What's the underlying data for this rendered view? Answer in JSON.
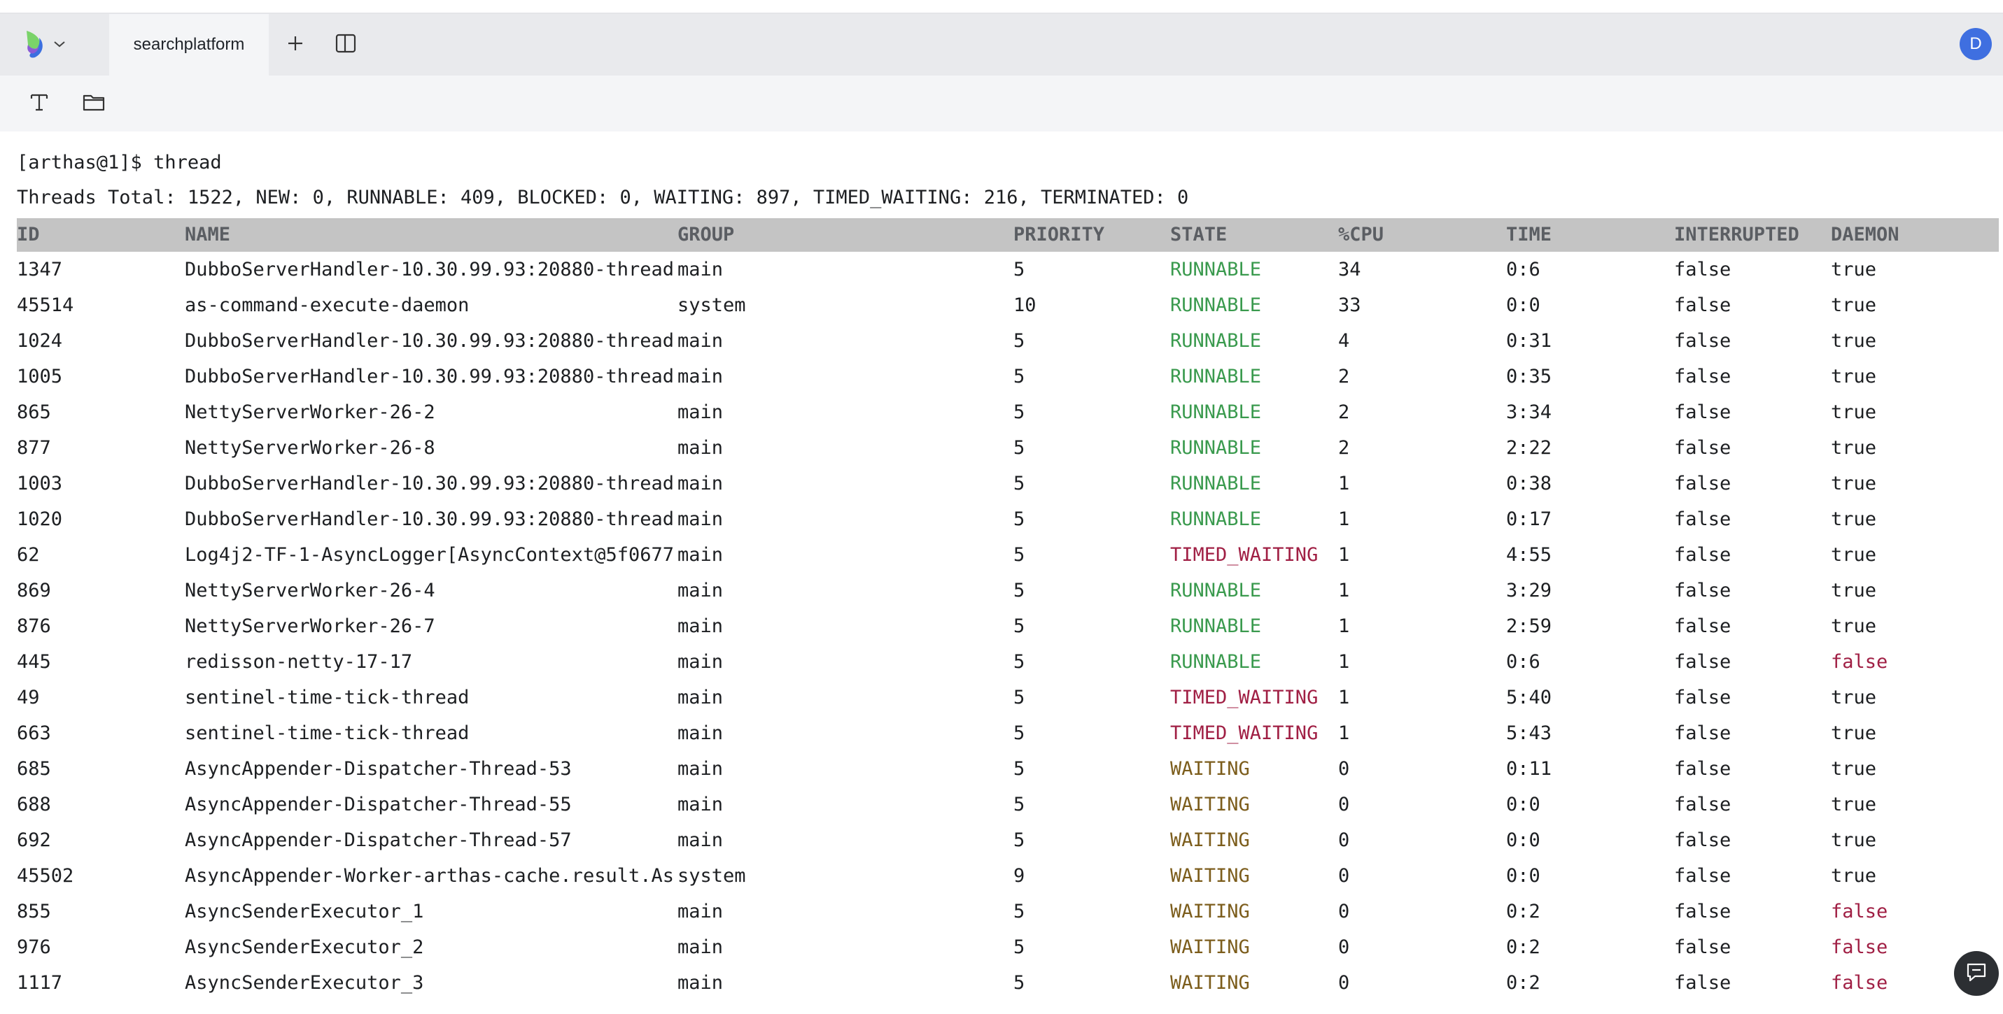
{
  "tabbar": {
    "tab_label": "searchplatform",
    "avatar_initial": "D"
  },
  "terminal": {
    "command_line": "[arthas@1]$ thread",
    "summary_line": "Threads Total: 1522, NEW: 0, RUNNABLE: 409, BLOCKED: 0, WAITING: 897, TIMED_WAITING: 216, TERMINATED: 0",
    "columns": [
      "ID",
      "NAME",
      "GROUP",
      "PRIORITY",
      "STATE",
      "%CPU",
      "TIME",
      "INTERRUPTED",
      "DAEMON"
    ],
    "rows": [
      [
        "1347",
        "DubboServerHandler-10.30.99.93:20880-thread",
        "main",
        "5",
        "RUNNABLE",
        "34",
        "0:6",
        "false",
        "true"
      ],
      [
        "45514",
        "as-command-execute-daemon",
        "system",
        "10",
        "RUNNABLE",
        "33",
        "0:0",
        "false",
        "true"
      ],
      [
        "1024",
        "DubboServerHandler-10.30.99.93:20880-thread",
        "main",
        "5",
        "RUNNABLE",
        "4",
        "0:31",
        "false",
        "true"
      ],
      [
        "1005",
        "DubboServerHandler-10.30.99.93:20880-thread",
        "main",
        "5",
        "RUNNABLE",
        "2",
        "0:35",
        "false",
        "true"
      ],
      [
        "865",
        "NettyServerWorker-26-2",
        "main",
        "5",
        "RUNNABLE",
        "2",
        "3:34",
        "false",
        "true"
      ],
      [
        "877",
        "NettyServerWorker-26-8",
        "main",
        "5",
        "RUNNABLE",
        "2",
        "2:22",
        "false",
        "true"
      ],
      [
        "1003",
        "DubboServerHandler-10.30.99.93:20880-thread",
        "main",
        "5",
        "RUNNABLE",
        "1",
        "0:38",
        "false",
        "true"
      ],
      [
        "1020",
        "DubboServerHandler-10.30.99.93:20880-thread",
        "main",
        "5",
        "RUNNABLE",
        "1",
        "0:17",
        "false",
        "true"
      ],
      [
        "62",
        "Log4j2-TF-1-AsyncLogger[AsyncContext@5f0677",
        "main",
        "5",
        "TIMED_WAITING",
        "1",
        "4:55",
        "false",
        "true"
      ],
      [
        "869",
        "NettyServerWorker-26-4",
        "main",
        "5",
        "RUNNABLE",
        "1",
        "3:29",
        "false",
        "true"
      ],
      [
        "876",
        "NettyServerWorker-26-7",
        "main",
        "5",
        "RUNNABLE",
        "1",
        "2:59",
        "false",
        "true"
      ],
      [
        "445",
        "redisson-netty-17-17",
        "main",
        "5",
        "RUNNABLE",
        "1",
        "0:6",
        "false",
        "false"
      ],
      [
        "49",
        "sentinel-time-tick-thread",
        "main",
        "5",
        "TIMED_WAITING",
        "1",
        "5:40",
        "false",
        "true"
      ],
      [
        "663",
        "sentinel-time-tick-thread",
        "main",
        "5",
        "TIMED_WAITING",
        "1",
        "5:43",
        "false",
        "true"
      ],
      [
        "685",
        "AsyncAppender-Dispatcher-Thread-53",
        "main",
        "5",
        "WAITING",
        "0",
        "0:11",
        "false",
        "true"
      ],
      [
        "688",
        "AsyncAppender-Dispatcher-Thread-55",
        "main",
        "5",
        "WAITING",
        "0",
        "0:0",
        "false",
        "true"
      ],
      [
        "692",
        "AsyncAppender-Dispatcher-Thread-57",
        "main",
        "5",
        "WAITING",
        "0",
        "0:0",
        "false",
        "true"
      ],
      [
        "45502",
        "AsyncAppender-Worker-arthas-cache.result.As",
        "system",
        "9",
        "WAITING",
        "0",
        "0:0",
        "false",
        "true"
      ],
      [
        "855",
        "AsyncSenderExecutor_1",
        "main",
        "5",
        "WAITING",
        "0",
        "0:2",
        "false",
        "false"
      ],
      [
        "976",
        "AsyncSenderExecutor_2",
        "main",
        "5",
        "WAITING",
        "0",
        "0:2",
        "false",
        "false"
      ],
      [
        "1117",
        "AsyncSenderExecutor_3",
        "main",
        "5",
        "WAITING",
        "0",
        "0:2",
        "false",
        "false"
      ]
    ]
  },
  "colors": {
    "state_runnable": "#3a9a4e",
    "state_timed_waiting": "#a01f44",
    "state_waiting": "#7c5d1c",
    "daemon_false": "#a01f44",
    "default_text": "#1d1f22"
  },
  "icons": {
    "app_logo": "app-logo-icon",
    "dropdown": "chevron-down-icon",
    "new_tab": "plus-icon",
    "split_view": "split-view-icon",
    "text_tool": "text-format-icon",
    "folder_tool": "folder-icon",
    "chat": "chat-icon"
  }
}
